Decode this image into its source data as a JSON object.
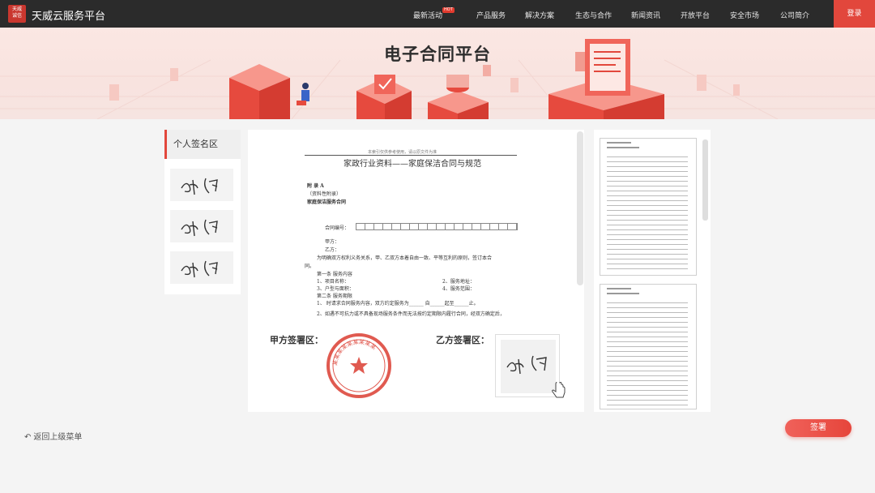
{
  "header": {
    "logo_text": "天威\n诚信",
    "brand": "天威云服务平台",
    "nav": [
      "最新活动",
      "产品服务",
      "解决方案",
      "生态与合作",
      "新闻资讯",
      "开放平台",
      "安全市场",
      "公司简介"
    ],
    "hot_badge": "HOT",
    "login": "登录"
  },
  "banner": {
    "title": "电子合同平台"
  },
  "sidebar": {
    "title": "个人签名区"
  },
  "document": {
    "top_note": "本索引仅供参考使用，请以原文件为准",
    "title": "家政行业资料——家庭保洁合同与规范",
    "lines": {
      "a": "附 录 A",
      "b": "（资料性附录）",
      "c": "家庭保洁服务合同",
      "contract_no": "合同编号：",
      "jia": "甲方：",
      "yi": "乙方：",
      "p1": "为明确双方权利义务关系，甲、乙双方本着自由一致、平等互利的原则，签订本合",
      "p1b": "同。",
      "s1": "第一条   服务内容",
      "i1": "1、项目名称：",
      "i2": "2、服务地址：",
      "i3": "3、户型与面积：",
      "i4": "4、服务范围：",
      "s2": "第二条   服务期限",
      "p2": "1、 时请求合同服务内容，双方约定服务为______ 自______起至______止。",
      "p3": "2、如遇不可抗力或不具备现场服务条件而无法按约定期限内履行合同，经双方确定后，"
    },
    "party_a": "甲方签署区：",
    "party_b": "乙方签署区：",
    "stamp_text": "某某某某某某某某某"
  },
  "footer": {
    "back": "返回上级菜单",
    "sign": "签署"
  },
  "colors": {
    "accent": "#e2473c",
    "topbar": "#2b2b2b"
  }
}
